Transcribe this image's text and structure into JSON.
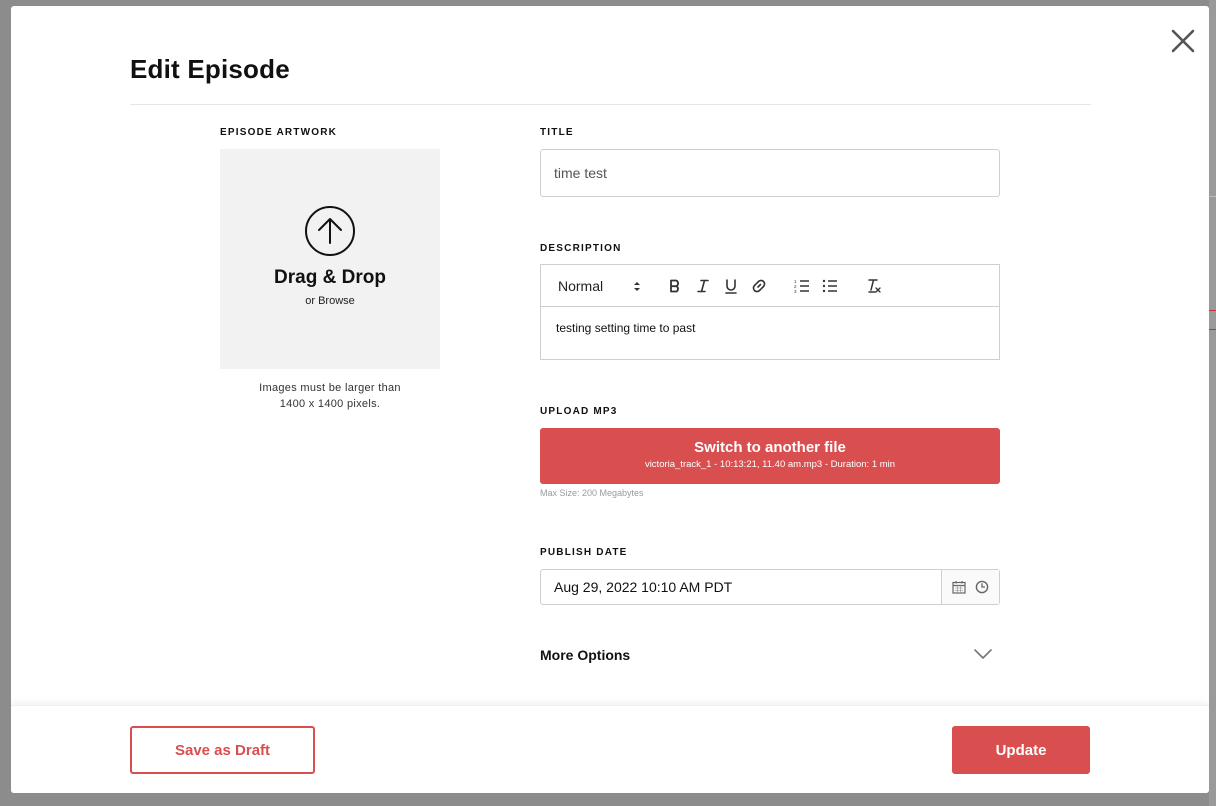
{
  "modal": {
    "title": "Edit Episode"
  },
  "artwork": {
    "label": "EPISODE ARTWORK",
    "drop_text": "Drag & Drop",
    "browse_text": "or Browse",
    "note_line1": "Images must be larger than",
    "note_line2": "1400 x 1400 pixels."
  },
  "title_field": {
    "label": "TITLE",
    "value": "time test"
  },
  "description": {
    "label": "DESCRIPTION",
    "format": "Normal",
    "body": "testing setting time to past",
    "toolbar_icons": [
      "bold-icon",
      "italic-icon",
      "underline-icon",
      "link-icon",
      "ordered-list-icon",
      "bullet-list-icon",
      "clear-format-icon"
    ]
  },
  "upload": {
    "label": "UPLOAD MP3",
    "button_main": "Switch to another file",
    "button_sub": "victoria_track_1 - 10:13:21, 11.40 am.mp3 - Duration: 1 min",
    "max_size": "Max Size: 200 Megabytes"
  },
  "publish": {
    "label": "PUBLISH DATE",
    "value": "Aug 29, 2022 10:10 AM PDT"
  },
  "more_options": {
    "label": "More Options"
  },
  "footer": {
    "draft_label": "Save as Draft",
    "update_label": "Update"
  },
  "colors": {
    "accent": "#d94f4f",
    "border": "#cfcfcf",
    "artwork_bg": "#f2f2f2"
  }
}
